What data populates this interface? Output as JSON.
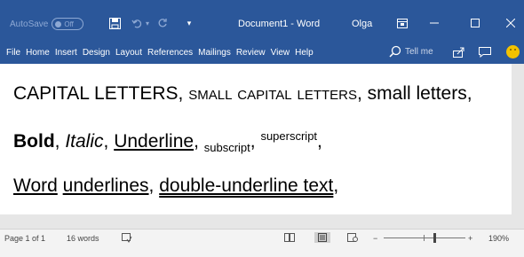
{
  "titlebar": {
    "autosave_label": "AutoSave",
    "autosave_state": "Off",
    "document_title": "Document1  -  Word",
    "user_name": "Olga",
    "icons": [
      "save-icon",
      "undo-icon",
      "redo-icon",
      "customize-qat-icon",
      "ribbon-display-options-icon",
      "minimize-icon",
      "maximize-icon",
      "close-icon"
    ]
  },
  "ribbon": {
    "tabs": [
      "File",
      "Home",
      "Insert",
      "Design",
      "Layout",
      "References",
      "Mailings",
      "Review",
      "View",
      "Help"
    ],
    "tell_me": "Tell me",
    "icons": [
      "lightbulb-search-icon",
      "share-icon",
      "comments-icon",
      "feedback-smiley-icon"
    ]
  },
  "document": {
    "line1": {
      "caps": "CAPITAL LETTERS",
      "sep1": ", ",
      "small_caps": "small capital letters",
      "sep2": ", ",
      "small": "small letters",
      "end": ","
    },
    "line2": {
      "bold": "Bold",
      "sep1": ", ",
      "italic": "Italic",
      "sep2": ", ",
      "underline": "Underline",
      "sep3": ", ",
      "subscript": "subscript",
      "sep4": ", ",
      "superscript": "superscript",
      "end": ","
    },
    "line3": {
      "word1": "Word",
      "sep1": " ",
      "word2": "underlines",
      "sep2": ", ",
      "double": "double-underline text",
      "end": ","
    }
  },
  "statusbar": {
    "page": "Page 1 of 1",
    "words": "16 words",
    "zoom_minus": "−",
    "zoom_plus": "+",
    "zoom_level": "190%",
    "zoom_fraction": 0.62
  },
  "colors": {
    "accent": "#2b579a",
    "statusbar_bg": "#f3f3f3"
  }
}
